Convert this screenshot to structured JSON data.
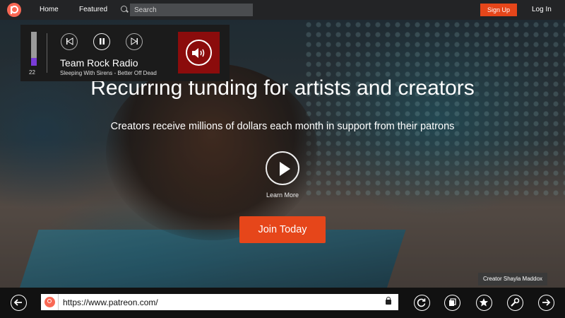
{
  "topnav": {
    "home": "Home",
    "featured": "Featured",
    "search_placeholder": "Search",
    "signup": "Sign Up",
    "login": "Log In"
  },
  "radio": {
    "volume_value": "22",
    "volume_fraction": 0.22,
    "station": "Team Rock Radio",
    "now_playing": "Sleeping With Sirens - Better Off Dead",
    "prev_icon": "skip-previous-icon",
    "pause_icon": "pause-icon",
    "next_icon": "skip-next-icon",
    "speaker_icon": "speaker-icon"
  },
  "hero": {
    "headline": "Recurring funding for artists and creators",
    "subline": "Creators receive millions of dollars each month in support from their patrons",
    "learn_more": "Learn More",
    "join": "Join Today",
    "credit": "Creator Shayla Maddox"
  },
  "browser": {
    "url": "https://www.patreon.com/",
    "icons": [
      "back-icon",
      "lock-icon",
      "refresh-icon",
      "tabs-icon",
      "favorites-icon",
      "tools-icon",
      "forward-icon"
    ]
  },
  "colors": {
    "brand": "#f96854",
    "cta": "#e6461a",
    "radio_tile": "#8b0c0c",
    "volume": "#7a3cd8"
  }
}
